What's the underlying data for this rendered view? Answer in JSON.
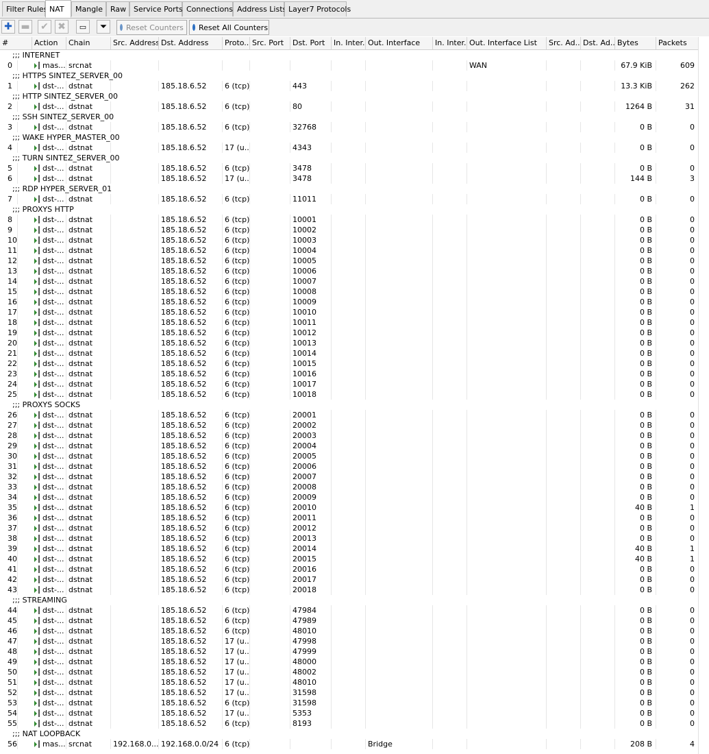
{
  "tabs": [
    "Filter Rules",
    "NAT",
    "Mangle",
    "Raw",
    "Service Ports",
    "Connections",
    "Address Lists",
    "Layer7 Protocols"
  ],
  "active_tab": "NAT",
  "toolbar": {
    "reset_counters": "Reset Counters",
    "reset_all_counters": "Reset All Counters"
  },
  "columns": [
    "#",
    "Action",
    "Chain",
    "Src. Address",
    "Dst. Address",
    "Proto...",
    "Src. Port",
    "Dst. Port",
    "In. Inter...",
    "Out. Interface",
    "In. Inter...",
    "Out. Interface List",
    "Src. Ad...",
    "Dst. Ad...",
    "Bytes",
    "Packets"
  ],
  "rows": [
    {
      "comment": ";;; INTERNET"
    },
    {
      "n": "0",
      "action": "mas...",
      "chain": "srcnat",
      "src": "",
      "dst": "",
      "proto": "",
      "dport": "",
      "out_if": "",
      "out_list": "WAN",
      "bytes": "67.9 KiB",
      "packets": "609"
    },
    {
      "comment": ";;; HTTPS SINTEZ_SERVER_00"
    },
    {
      "n": "1",
      "action": "dst-...",
      "chain": "dstnat",
      "src": "",
      "dst": "185.18.6.52",
      "proto": "6 (tcp)",
      "dport": "443",
      "out_if": "",
      "out_list": "",
      "bytes": "13.3 KiB",
      "packets": "262"
    },
    {
      "comment": ";;; HTTP SINTEZ_SERVER_00"
    },
    {
      "n": "2",
      "action": "dst-...",
      "chain": "dstnat",
      "src": "",
      "dst": "185.18.6.52",
      "proto": "6 (tcp)",
      "dport": "80",
      "out_if": "",
      "out_list": "",
      "bytes": "1264 B",
      "packets": "31"
    },
    {
      "comment": ";;; SSH SINTEZ_SERVER_00"
    },
    {
      "n": "3",
      "action": "dst-...",
      "chain": "dstnat",
      "src": "",
      "dst": "185.18.6.52",
      "proto": "6 (tcp)",
      "dport": "32768",
      "out_if": "",
      "out_list": "",
      "bytes": "0 B",
      "packets": "0"
    },
    {
      "comment": ";;; WAKE HYPER_MASTER_00"
    },
    {
      "n": "4",
      "action": "dst-...",
      "chain": "dstnat",
      "src": "",
      "dst": "185.18.6.52",
      "proto": "17 (u...",
      "dport": "4343",
      "out_if": "",
      "out_list": "",
      "bytes": "0 B",
      "packets": "0"
    },
    {
      "comment": ";;; TURN SINTEZ_SERVER_00"
    },
    {
      "n": "5",
      "action": "dst-...",
      "chain": "dstnat",
      "src": "",
      "dst": "185.18.6.52",
      "proto": "6 (tcp)",
      "dport": "3478",
      "out_if": "",
      "out_list": "",
      "bytes": "0 B",
      "packets": "0"
    },
    {
      "n": "6",
      "action": "dst-...",
      "chain": "dstnat",
      "src": "",
      "dst": "185.18.6.52",
      "proto": "17 (u...",
      "dport": "3478",
      "out_if": "",
      "out_list": "",
      "bytes": "144 B",
      "packets": "3"
    },
    {
      "comment": ";;; RDP HYPER_SERVER_01"
    },
    {
      "n": "7",
      "action": "dst-...",
      "chain": "dstnat",
      "src": "",
      "dst": "185.18.6.52",
      "proto": "6 (tcp)",
      "dport": "11011",
      "out_if": "",
      "out_list": "",
      "bytes": "0 B",
      "packets": "0"
    },
    {
      "comment": ";;; PROXYS HTTP"
    },
    {
      "n": "8",
      "action": "dst-...",
      "chain": "dstnat",
      "src": "",
      "dst": "185.18.6.52",
      "proto": "6 (tcp)",
      "dport": "10001",
      "out_if": "",
      "out_list": "",
      "bytes": "0 B",
      "packets": "0"
    },
    {
      "n": "9",
      "action": "dst-...",
      "chain": "dstnat",
      "src": "",
      "dst": "185.18.6.52",
      "proto": "6 (tcp)",
      "dport": "10002",
      "out_if": "",
      "out_list": "",
      "bytes": "0 B",
      "packets": "0"
    },
    {
      "n": "10",
      "action": "dst-...",
      "chain": "dstnat",
      "src": "",
      "dst": "185.18.6.52",
      "proto": "6 (tcp)",
      "dport": "10003",
      "out_if": "",
      "out_list": "",
      "bytes": "0 B",
      "packets": "0"
    },
    {
      "n": "11",
      "action": "dst-...",
      "chain": "dstnat",
      "src": "",
      "dst": "185.18.6.52",
      "proto": "6 (tcp)",
      "dport": "10004",
      "out_if": "",
      "out_list": "",
      "bytes": "0 B",
      "packets": "0"
    },
    {
      "n": "12",
      "action": "dst-...",
      "chain": "dstnat",
      "src": "",
      "dst": "185.18.6.52",
      "proto": "6 (tcp)",
      "dport": "10005",
      "out_if": "",
      "out_list": "",
      "bytes": "0 B",
      "packets": "0"
    },
    {
      "n": "13",
      "action": "dst-...",
      "chain": "dstnat",
      "src": "",
      "dst": "185.18.6.52",
      "proto": "6 (tcp)",
      "dport": "10006",
      "out_if": "",
      "out_list": "",
      "bytes": "0 B",
      "packets": "0"
    },
    {
      "n": "14",
      "action": "dst-...",
      "chain": "dstnat",
      "src": "",
      "dst": "185.18.6.52",
      "proto": "6 (tcp)",
      "dport": "10007",
      "out_if": "",
      "out_list": "",
      "bytes": "0 B",
      "packets": "0"
    },
    {
      "n": "15",
      "action": "dst-...",
      "chain": "dstnat",
      "src": "",
      "dst": "185.18.6.52",
      "proto": "6 (tcp)",
      "dport": "10008",
      "out_if": "",
      "out_list": "",
      "bytes": "0 B",
      "packets": "0"
    },
    {
      "n": "16",
      "action": "dst-...",
      "chain": "dstnat",
      "src": "",
      "dst": "185.18.6.52",
      "proto": "6 (tcp)",
      "dport": "10009",
      "out_if": "",
      "out_list": "",
      "bytes": "0 B",
      "packets": "0"
    },
    {
      "n": "17",
      "action": "dst-...",
      "chain": "dstnat",
      "src": "",
      "dst": "185.18.6.52",
      "proto": "6 (tcp)",
      "dport": "10010",
      "out_if": "",
      "out_list": "",
      "bytes": "0 B",
      "packets": "0"
    },
    {
      "n": "18",
      "action": "dst-...",
      "chain": "dstnat",
      "src": "",
      "dst": "185.18.6.52",
      "proto": "6 (tcp)",
      "dport": "10011",
      "out_if": "",
      "out_list": "",
      "bytes": "0 B",
      "packets": "0"
    },
    {
      "n": "19",
      "action": "dst-...",
      "chain": "dstnat",
      "src": "",
      "dst": "185.18.6.52",
      "proto": "6 (tcp)",
      "dport": "10012",
      "out_if": "",
      "out_list": "",
      "bytes": "0 B",
      "packets": "0"
    },
    {
      "n": "20",
      "action": "dst-...",
      "chain": "dstnat",
      "src": "",
      "dst": "185.18.6.52",
      "proto": "6 (tcp)",
      "dport": "10013",
      "out_if": "",
      "out_list": "",
      "bytes": "0 B",
      "packets": "0"
    },
    {
      "n": "21",
      "action": "dst-...",
      "chain": "dstnat",
      "src": "",
      "dst": "185.18.6.52",
      "proto": "6 (tcp)",
      "dport": "10014",
      "out_if": "",
      "out_list": "",
      "bytes": "0 B",
      "packets": "0"
    },
    {
      "n": "22",
      "action": "dst-...",
      "chain": "dstnat",
      "src": "",
      "dst": "185.18.6.52",
      "proto": "6 (tcp)",
      "dport": "10015",
      "out_if": "",
      "out_list": "",
      "bytes": "0 B",
      "packets": "0"
    },
    {
      "n": "23",
      "action": "dst-...",
      "chain": "dstnat",
      "src": "",
      "dst": "185.18.6.52",
      "proto": "6 (tcp)",
      "dport": "10016",
      "out_if": "",
      "out_list": "",
      "bytes": "0 B",
      "packets": "0"
    },
    {
      "n": "24",
      "action": "dst-...",
      "chain": "dstnat",
      "src": "",
      "dst": "185.18.6.52",
      "proto": "6 (tcp)",
      "dport": "10017",
      "out_if": "",
      "out_list": "",
      "bytes": "0 B",
      "packets": "0"
    },
    {
      "n": "25",
      "action": "dst-...",
      "chain": "dstnat",
      "src": "",
      "dst": "185.18.6.52",
      "proto": "6 (tcp)",
      "dport": "10018",
      "out_if": "",
      "out_list": "",
      "bytes": "0 B",
      "packets": "0"
    },
    {
      "comment": ";;; PROXYS SOCKS"
    },
    {
      "n": "26",
      "action": "dst-...",
      "chain": "dstnat",
      "src": "",
      "dst": "185.18.6.52",
      "proto": "6 (tcp)",
      "dport": "20001",
      "out_if": "",
      "out_list": "",
      "bytes": "0 B",
      "packets": "0"
    },
    {
      "n": "27",
      "action": "dst-...",
      "chain": "dstnat",
      "src": "",
      "dst": "185.18.6.52",
      "proto": "6 (tcp)",
      "dport": "20002",
      "out_if": "",
      "out_list": "",
      "bytes": "0 B",
      "packets": "0"
    },
    {
      "n": "28",
      "action": "dst-...",
      "chain": "dstnat",
      "src": "",
      "dst": "185.18.6.52",
      "proto": "6 (tcp)",
      "dport": "20003",
      "out_if": "",
      "out_list": "",
      "bytes": "0 B",
      "packets": "0"
    },
    {
      "n": "29",
      "action": "dst-...",
      "chain": "dstnat",
      "src": "",
      "dst": "185.18.6.52",
      "proto": "6 (tcp)",
      "dport": "20004",
      "out_if": "",
      "out_list": "",
      "bytes": "0 B",
      "packets": "0"
    },
    {
      "n": "30",
      "action": "dst-...",
      "chain": "dstnat",
      "src": "",
      "dst": "185.18.6.52",
      "proto": "6 (tcp)",
      "dport": "20005",
      "out_if": "",
      "out_list": "",
      "bytes": "0 B",
      "packets": "0"
    },
    {
      "n": "31",
      "action": "dst-...",
      "chain": "dstnat",
      "src": "",
      "dst": "185.18.6.52",
      "proto": "6 (tcp)",
      "dport": "20006",
      "out_if": "",
      "out_list": "",
      "bytes": "0 B",
      "packets": "0"
    },
    {
      "n": "32",
      "action": "dst-...",
      "chain": "dstnat",
      "src": "",
      "dst": "185.18.6.52",
      "proto": "6 (tcp)",
      "dport": "20007",
      "out_if": "",
      "out_list": "",
      "bytes": "0 B",
      "packets": "0"
    },
    {
      "n": "33",
      "action": "dst-...",
      "chain": "dstnat",
      "src": "",
      "dst": "185.18.6.52",
      "proto": "6 (tcp)",
      "dport": "20008",
      "out_if": "",
      "out_list": "",
      "bytes": "0 B",
      "packets": "0"
    },
    {
      "n": "34",
      "action": "dst-...",
      "chain": "dstnat",
      "src": "",
      "dst": "185.18.6.52",
      "proto": "6 (tcp)",
      "dport": "20009",
      "out_if": "",
      "out_list": "",
      "bytes": "0 B",
      "packets": "0"
    },
    {
      "n": "35",
      "action": "dst-...",
      "chain": "dstnat",
      "src": "",
      "dst": "185.18.6.52",
      "proto": "6 (tcp)",
      "dport": "20010",
      "out_if": "",
      "out_list": "",
      "bytes": "40 B",
      "packets": "1"
    },
    {
      "n": "36",
      "action": "dst-...",
      "chain": "dstnat",
      "src": "",
      "dst": "185.18.6.52",
      "proto": "6 (tcp)",
      "dport": "20011",
      "out_if": "",
      "out_list": "",
      "bytes": "0 B",
      "packets": "0"
    },
    {
      "n": "37",
      "action": "dst-...",
      "chain": "dstnat",
      "src": "",
      "dst": "185.18.6.52",
      "proto": "6 (tcp)",
      "dport": "20012",
      "out_if": "",
      "out_list": "",
      "bytes": "0 B",
      "packets": "0"
    },
    {
      "n": "38",
      "action": "dst-...",
      "chain": "dstnat",
      "src": "",
      "dst": "185.18.6.52",
      "proto": "6 (tcp)",
      "dport": "20013",
      "out_if": "",
      "out_list": "",
      "bytes": "0 B",
      "packets": "0"
    },
    {
      "n": "39",
      "action": "dst-...",
      "chain": "dstnat",
      "src": "",
      "dst": "185.18.6.52",
      "proto": "6 (tcp)",
      "dport": "20014",
      "out_if": "",
      "out_list": "",
      "bytes": "40 B",
      "packets": "1"
    },
    {
      "n": "40",
      "action": "dst-...",
      "chain": "dstnat",
      "src": "",
      "dst": "185.18.6.52",
      "proto": "6 (tcp)",
      "dport": "20015",
      "out_if": "",
      "out_list": "",
      "bytes": "40 B",
      "packets": "1"
    },
    {
      "n": "41",
      "action": "dst-...",
      "chain": "dstnat",
      "src": "",
      "dst": "185.18.6.52",
      "proto": "6 (tcp)",
      "dport": "20016",
      "out_if": "",
      "out_list": "",
      "bytes": "0 B",
      "packets": "0"
    },
    {
      "n": "42",
      "action": "dst-...",
      "chain": "dstnat",
      "src": "",
      "dst": "185.18.6.52",
      "proto": "6 (tcp)",
      "dport": "20017",
      "out_if": "",
      "out_list": "",
      "bytes": "0 B",
      "packets": "0"
    },
    {
      "n": "43",
      "action": "dst-...",
      "chain": "dstnat",
      "src": "",
      "dst": "185.18.6.52",
      "proto": "6 (tcp)",
      "dport": "20018",
      "out_if": "",
      "out_list": "",
      "bytes": "0 B",
      "packets": "0"
    },
    {
      "comment": ";;; STREAMING"
    },
    {
      "n": "44",
      "action": "dst-...",
      "chain": "dstnat",
      "src": "",
      "dst": "185.18.6.52",
      "proto": "6 (tcp)",
      "dport": "47984",
      "out_if": "",
      "out_list": "",
      "bytes": "0 B",
      "packets": "0"
    },
    {
      "n": "45",
      "action": "dst-...",
      "chain": "dstnat",
      "src": "",
      "dst": "185.18.6.52",
      "proto": "6 (tcp)",
      "dport": "47989",
      "out_if": "",
      "out_list": "",
      "bytes": "0 B",
      "packets": "0"
    },
    {
      "n": "46",
      "action": "dst-...",
      "chain": "dstnat",
      "src": "",
      "dst": "185.18.6.52",
      "proto": "6 (tcp)",
      "dport": "48010",
      "out_if": "",
      "out_list": "",
      "bytes": "0 B",
      "packets": "0"
    },
    {
      "n": "47",
      "action": "dst-...",
      "chain": "dstnat",
      "src": "",
      "dst": "185.18.6.52",
      "proto": "17 (u...",
      "dport": "47998",
      "out_if": "",
      "out_list": "",
      "bytes": "0 B",
      "packets": "0"
    },
    {
      "n": "48",
      "action": "dst-...",
      "chain": "dstnat",
      "src": "",
      "dst": "185.18.6.52",
      "proto": "17 (u...",
      "dport": "47999",
      "out_if": "",
      "out_list": "",
      "bytes": "0 B",
      "packets": "0"
    },
    {
      "n": "49",
      "action": "dst-...",
      "chain": "dstnat",
      "src": "",
      "dst": "185.18.6.52",
      "proto": "17 (u...",
      "dport": "48000",
      "out_if": "",
      "out_list": "",
      "bytes": "0 B",
      "packets": "0"
    },
    {
      "n": "50",
      "action": "dst-...",
      "chain": "dstnat",
      "src": "",
      "dst": "185.18.6.52",
      "proto": "17 (u...",
      "dport": "48002",
      "out_if": "",
      "out_list": "",
      "bytes": "0 B",
      "packets": "0"
    },
    {
      "n": "51",
      "action": "dst-...",
      "chain": "dstnat",
      "src": "",
      "dst": "185.18.6.52",
      "proto": "17 (u...",
      "dport": "48010",
      "out_if": "",
      "out_list": "",
      "bytes": "0 B",
      "packets": "0"
    },
    {
      "n": "52",
      "action": "dst-...",
      "chain": "dstnat",
      "src": "",
      "dst": "185.18.6.52",
      "proto": "17 (u...",
      "dport": "31598",
      "out_if": "",
      "out_list": "",
      "bytes": "0 B",
      "packets": "0"
    },
    {
      "n": "53",
      "action": "dst-...",
      "chain": "dstnat",
      "src": "",
      "dst": "185.18.6.52",
      "proto": "6 (tcp)",
      "dport": "31598",
      "out_if": "",
      "out_list": "",
      "bytes": "0 B",
      "packets": "0"
    },
    {
      "n": "54",
      "action": "dst-...",
      "chain": "dstnat",
      "src": "",
      "dst": "185.18.6.52",
      "proto": "17 (u...",
      "dport": "5353",
      "out_if": "",
      "out_list": "",
      "bytes": "0 B",
      "packets": "0"
    },
    {
      "n": "55",
      "action": "dst-...",
      "chain": "dstnat",
      "src": "",
      "dst": "185.18.6.52",
      "proto": "6 (tcp)",
      "dport": "8193",
      "out_if": "",
      "out_list": "",
      "bytes": "0 B",
      "packets": "0"
    },
    {
      "comment": ";;; NAT LOOPBACK"
    },
    {
      "n": "56",
      "action": "mas...",
      "chain": "srcnat",
      "src": "192.168.0....",
      "dst": "192.168.0.0/24",
      "proto": "6 (tcp)",
      "dport": "",
      "out_if": "Bridge",
      "out_list": "",
      "bytes": "208 B",
      "packets": "4"
    }
  ]
}
